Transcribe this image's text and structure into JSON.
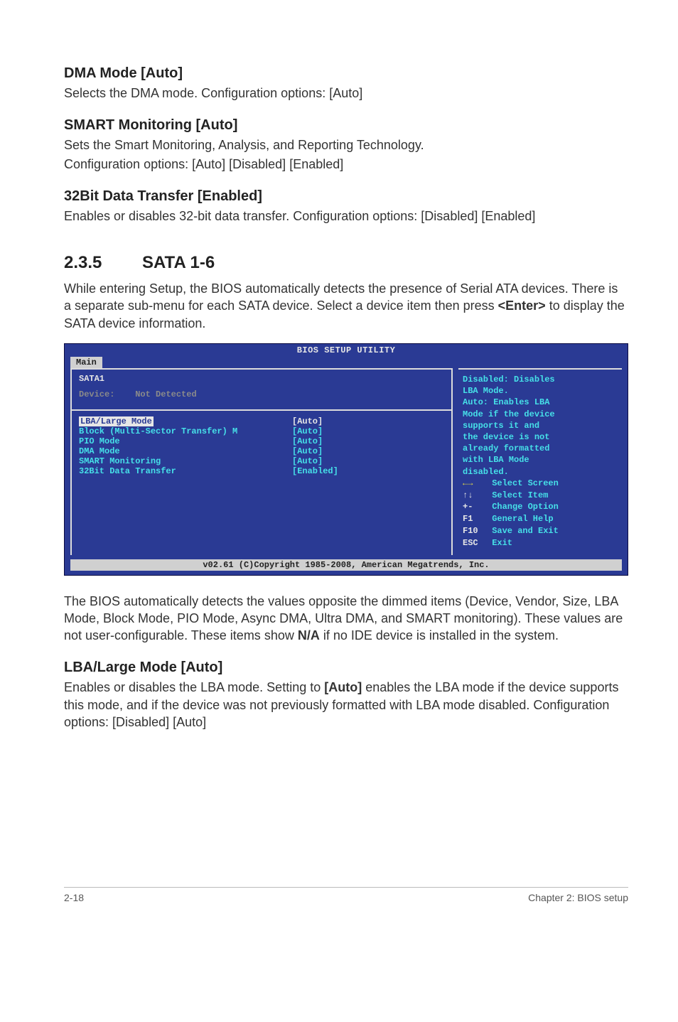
{
  "sections": {
    "dma": {
      "heading": "DMA Mode [Auto]",
      "body": "Selects the DMA mode. Configuration options: [Auto]"
    },
    "smart": {
      "heading": "SMART Monitoring [Auto]",
      "body1": "Sets the Smart Monitoring, Analysis, and Reporting Technology.",
      "body2": "Configuration options: [Auto] [Disabled] [Enabled]"
    },
    "bit32": {
      "heading": "32Bit Data Transfer [Enabled]",
      "body": "Enables or disables 32-bit data transfer. Configuration options: [Disabled] [Enabled]"
    },
    "sata": {
      "num": "2.3.5",
      "title": "SATA 1-6",
      "intro1": "While entering Setup, the BIOS automatically detects the presence of Serial ATA devices. There is a separate sub-menu for each SATA device. Select a device item then press ",
      "intro_key": "<Enter>",
      "intro2": " to display the SATA device information."
    },
    "after": {
      "p1a": "The BIOS automatically detects the values opposite the dimmed items (Device, Vendor, Size, LBA Mode, Block Mode, PIO Mode, Async DMA, Ultra DMA, and SMART monitoring). These values are not user-configurable. These items show ",
      "p1b": "N/A",
      "p1c": " if no IDE device is installed in the system."
    },
    "lba": {
      "heading": "LBA/Large Mode [Auto]",
      "b1": "Enables or disables the LBA mode. Setting to ",
      "b_auto": "[Auto]",
      "b2": " enables the LBA mode if the device supports this mode, and if the device was not previously formatted with LBA mode disabled. Configuration options: [Disabled] [Auto]"
    }
  },
  "bios": {
    "title": "BIOS SETUP UTILITY",
    "tab": "Main",
    "header": {
      "sata": "SATA1",
      "device_label": "Device:",
      "device_value": "Not Detected"
    },
    "items": [
      {
        "label": "LBA/Large Mode",
        "value": "[Auto]",
        "selected": true
      },
      {
        "label": "Block (Multi-Sector Transfer) M",
        "value": "[Auto]",
        "selected": false
      },
      {
        "label": "PIO Mode",
        "value": "[Auto]",
        "selected": false
      },
      {
        "label": "DMA Mode",
        "value": "[Auto]",
        "selected": false
      },
      {
        "label": "SMART Monitoring",
        "value": "[Auto]",
        "selected": false
      },
      {
        "label": "32Bit Data Transfer",
        "value": "[Enabled]",
        "selected": false
      }
    ],
    "help": [
      "Disabled: Disables",
      "LBA Mode.",
      "Auto: Enables LBA",
      "Mode if the device",
      "supports it and",
      "the device is not",
      "already formatted",
      "with LBA Mode",
      "disabled."
    ],
    "nav": [
      {
        "key": "←→",
        "text": "Select Screen",
        "arrow": true
      },
      {
        "key": "↑↓",
        "text": "Select Item",
        "arrow": false
      },
      {
        "key": "+-",
        "text": "Change Option",
        "arrow": false
      },
      {
        "key": "F1",
        "text": "General Help",
        "arrow": false
      },
      {
        "key": "F10",
        "text": "Save and Exit",
        "arrow": false
      },
      {
        "key": "ESC",
        "text": "Exit",
        "arrow": false
      }
    ],
    "footer": "v02.61 (C)Copyright 1985-2008, American Megatrends, Inc."
  },
  "pagefoot": {
    "left": "2-18",
    "right": "Chapter 2: BIOS setup"
  }
}
